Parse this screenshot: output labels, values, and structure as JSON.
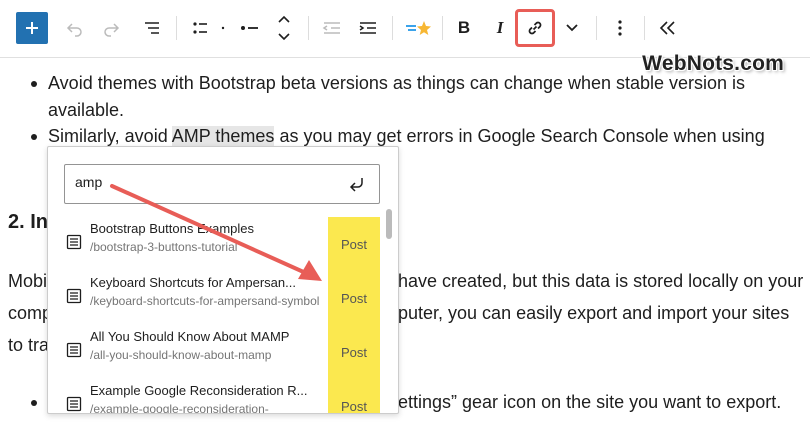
{
  "toolbar": {
    "bold_label": "B",
    "italic_label": "I"
  },
  "watermark": "WebNots.com",
  "content": {
    "bullet1_line1": "Avoid themes with Bootstrap beta versions as things can change when stable version is",
    "bullet1_line2": "available.",
    "bullet2_pre": "Similarly, avoid ",
    "bullet2_highlight": "AMP themes",
    "bullet2_post": " as you may get errors in Google Search Console when using",
    "heading_visible": "2. In",
    "para_line1_left": "Mobi",
    "para_line1_right": "have created, but this data is stored locally on your",
    "para_line2_left": "comp",
    "para_line2_right": "puter, you can easily export and import your sites",
    "para_line3_left": "to tra",
    "bullet3_right": "ettings” gear icon on the site you want to export."
  },
  "link_popover": {
    "search_value": "amp",
    "results": [
      {
        "title": "Bootstrap Buttons Examples",
        "url": "/bootstrap-3-buttons-tutorial",
        "type": "Post"
      },
      {
        "title": "Keyboard Shortcuts for Ampersan...",
        "url": "/keyboard-shortcuts-for-ampersand-symbol",
        "type": "Post"
      },
      {
        "title": "All You Should Know About MAMP",
        "url": "/all-you-should-know-about-mamp",
        "type": "Post"
      },
      {
        "title": "Example Google Reconsideration R...",
        "url": "/example-google-reconsideration-",
        "type": "Post"
      }
    ]
  },
  "colors": {
    "accent": "#2271b1",
    "highlight_box": "#e85d57",
    "type_badge": "#fbe84f"
  }
}
